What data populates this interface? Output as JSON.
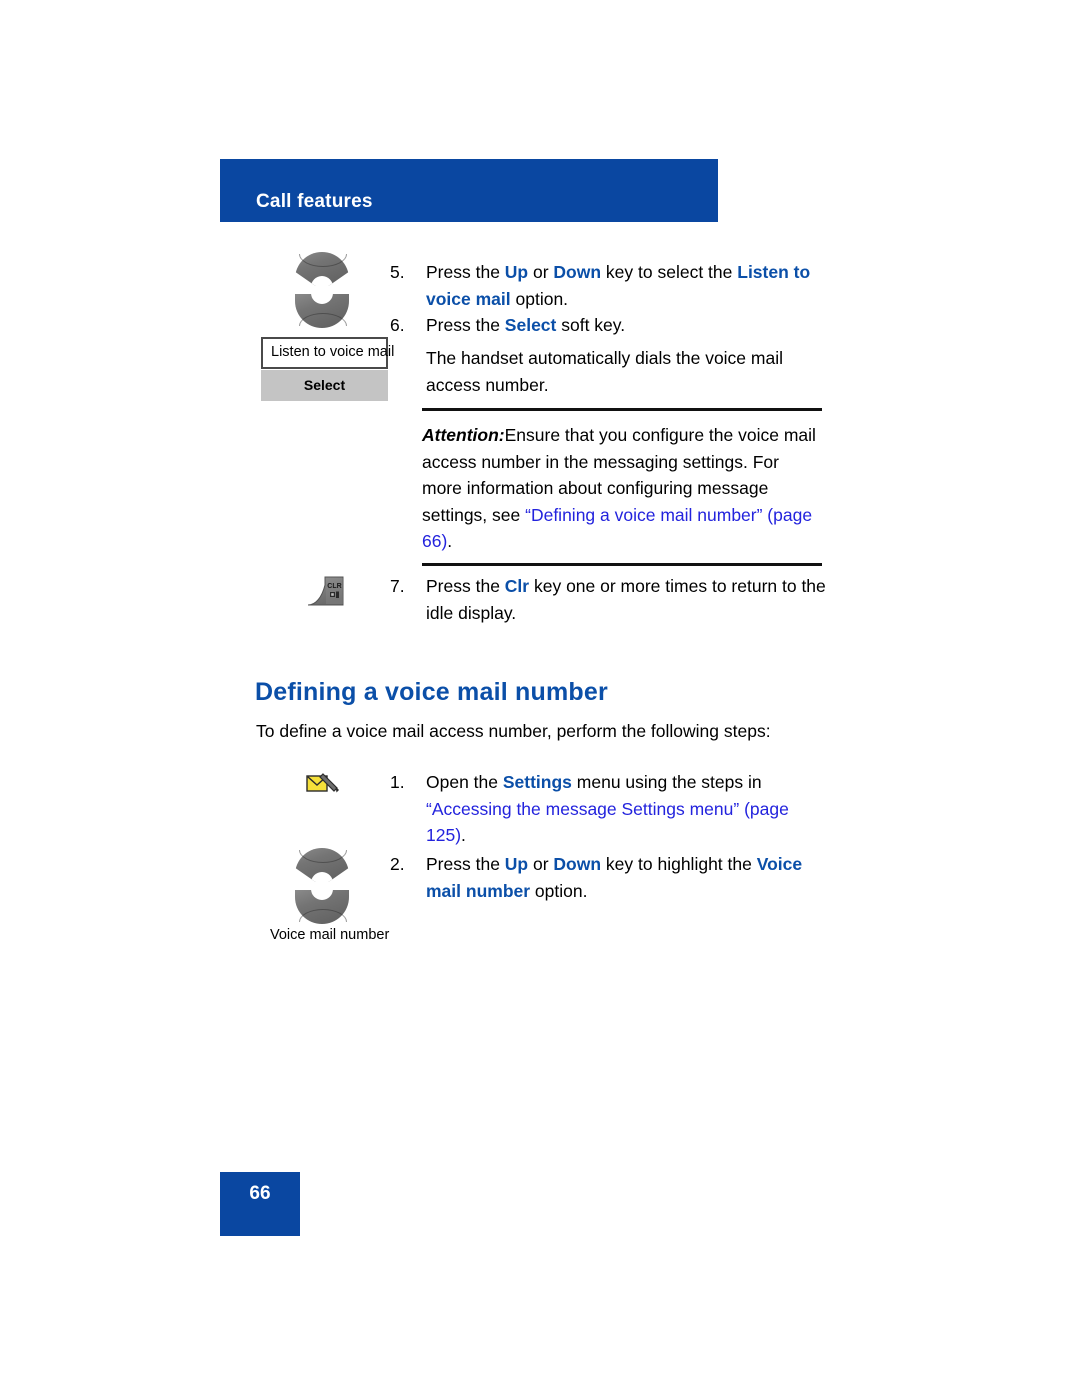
{
  "header": {
    "title": "Call features",
    "banner_color": "#0a47a1"
  },
  "colors": {
    "brand_blue": "#0a47a1",
    "keyword_blue": "#0b4fa8",
    "xref_blue": "#2323dd",
    "key_gray": "#6f6f6f",
    "softkey_gray": "#c4c4c4"
  },
  "steps_top": [
    {
      "number": "5.",
      "pre": "Press the ",
      "kw1": "Up",
      "mid1": " or ",
      "kw2": "Down",
      "mid2": " key to select the ",
      "kw3": "Listen to voice mail",
      "post": " option."
    },
    {
      "number": "6.",
      "pre": "Press the ",
      "kw1": "Select",
      "post": " soft key."
    }
  ],
  "step6_result": "The handset automatically dials the voice mail access number.",
  "top_icons": {
    "rocker_icon_name": "up-down-navigation-key",
    "display_box_text": "Listen to voice mail",
    "softkey_label": "Select"
  },
  "attention": {
    "label": "Attention:",
    "body_before_link": "Ensure that you configure the voice mail access number in the messaging settings. For more information about configuring message settings, see ",
    "link_text": "“Defining a voice mail number” (page 66)",
    "body_after_link": "."
  },
  "step7": {
    "number": "7.",
    "pre": "Press the ",
    "kw1": "Clr",
    "post": " key one or more times to return to the idle display.",
    "icon_name": "clr-key",
    "icon_label": "CLR"
  },
  "section": {
    "heading": "Defining a voice mail number",
    "intro": "To define a voice mail access number, perform the following steps:"
  },
  "steps_bottom": [
    {
      "number": "1.",
      "pre": "Open the ",
      "kw1": "Settings",
      "mid1": " menu using the steps in ",
      "link_text": "“Accessing the message Settings menu” (page 125)",
      "post": ".",
      "icon_name": "message-settings-icon"
    },
    {
      "number": "2.",
      "pre": "Press the ",
      "kw1": "Up",
      "mid1": " or ",
      "kw2": "Down",
      "mid2": " key to highlight the ",
      "kw3": "Voice mail number",
      "post": " option.",
      "icon_name": "up-down-navigation-key",
      "caption": "Voice mail number"
    }
  ],
  "footer": {
    "page_number": "66"
  }
}
